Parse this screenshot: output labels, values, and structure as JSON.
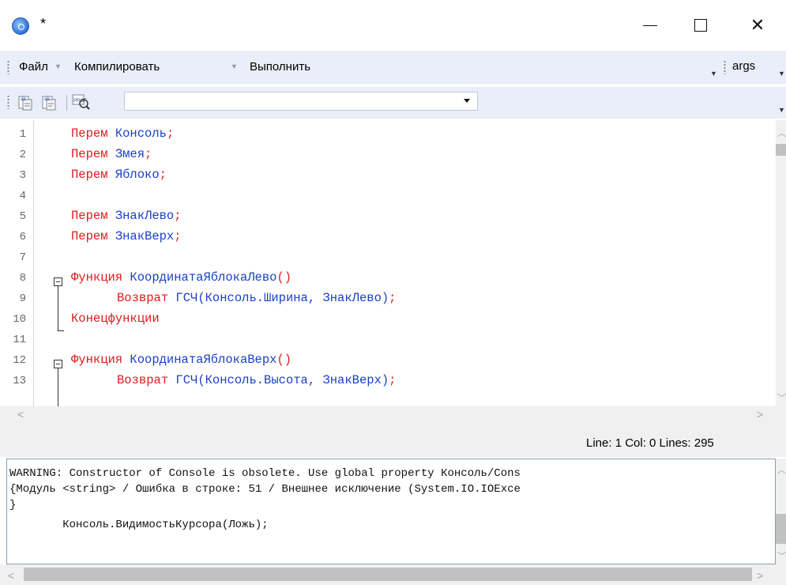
{
  "window": {
    "title": "*",
    "minimize_icon": "minimize-icon",
    "maximize_icon": "maximize-icon",
    "close_symbol": "✕"
  },
  "menubar": {
    "items": [
      {
        "label": "Файл",
        "has_dropdown": true
      },
      {
        "label": "Компилировать",
        "has_dropdown": true
      },
      {
        "label": "Выполнить",
        "has_dropdown": false
      }
    ],
    "args_label": "args"
  },
  "toolbar": {
    "icons": [
      "text-format-icon",
      "text-format-alt-icon",
      "profiler-icon"
    ],
    "combo_value": ""
  },
  "editor": {
    "line_numbers": [
      "1",
      "2",
      "3",
      "4",
      "5",
      "6",
      "7",
      "8",
      "9",
      "10",
      "11",
      "12",
      "13"
    ],
    "lines": [
      {
        "kw": "Перем",
        "rest": " Консоль",
        "end": ";"
      },
      {
        "kw": "Перем",
        "rest": " Змея",
        "end": ";"
      },
      {
        "kw": "Перем",
        "rest": " Яблоко",
        "end": ";"
      },
      {
        "kw": "",
        "rest": "",
        "end": ""
      },
      {
        "kw": "Перем",
        "rest": " ЗнакЛево",
        "end": ";"
      },
      {
        "kw": "Перем",
        "rest": " ЗнакВерх",
        "end": ";"
      },
      {
        "kw": "",
        "rest": "",
        "end": ""
      },
      {
        "kw": "Функция",
        "rest": " КоординатаЯблокаЛево",
        "end": "()"
      },
      {
        "kw": "Возврат",
        "rest": " ГСЧ(Консоль.Ширина, ЗнакЛево)",
        "end": ";"
      },
      {
        "kw": "Конецфункции",
        "rest": "",
        "end": ""
      },
      {
        "kw": "",
        "rest": "",
        "end": ""
      },
      {
        "kw": "Функция",
        "rest": " КоординатаЯблокаВерх",
        "end": "()"
      },
      {
        "kw": "Возврат",
        "rest": " ГСЧ(Консоль.Высота, ЗнакВерх)",
        "end": ";"
      }
    ]
  },
  "status": {
    "text": "Line:  1  Col:  0  Lines:  295"
  },
  "console": {
    "lines": [
      "WARNING: Constructor of Console is obsolete. Use global property Консоль/Cons",
      "{Модуль <string> / Ошибка в строке: 51 / Внешнее исключение (System.IO.IOExce",
      "}",
      "        Консоль.ВидимостьКурсора(Ложь);"
    ]
  },
  "colors": {
    "keyword": "#e01b1b",
    "identifier": "#1a3fc8",
    "toolbar_bg": "#e9eef8"
  }
}
